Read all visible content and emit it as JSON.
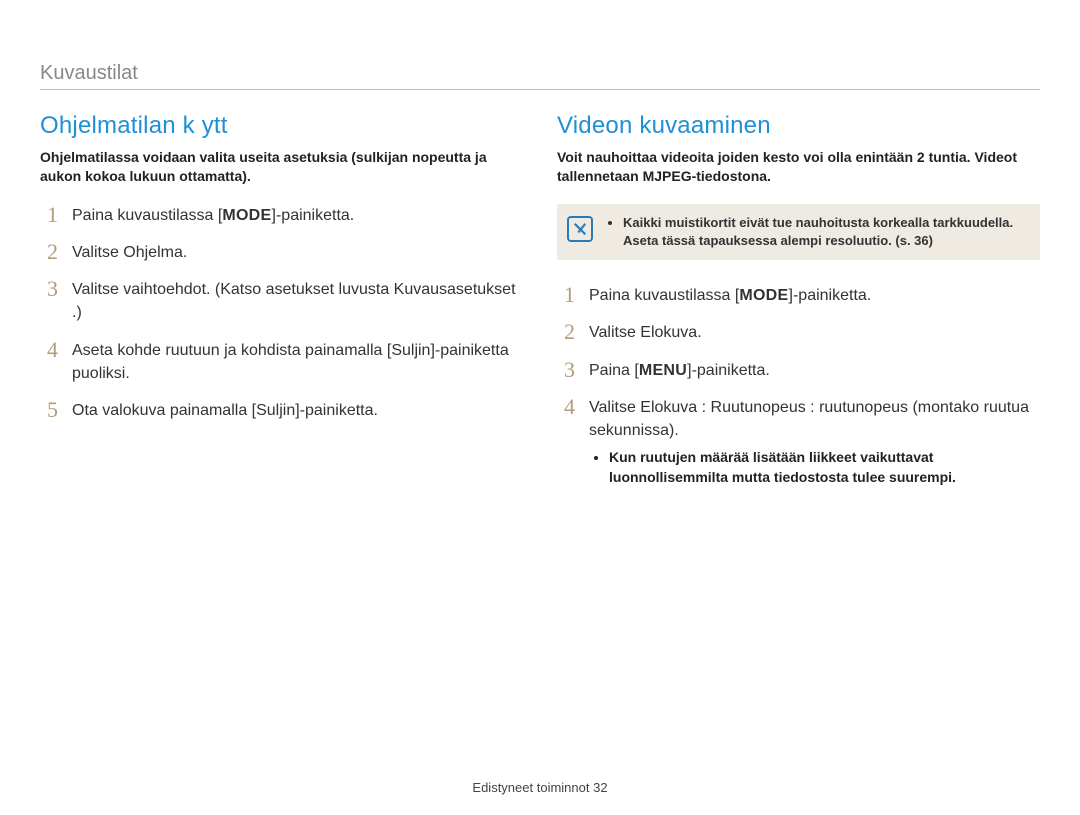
{
  "topic": "Kuvaustilat",
  "left": {
    "title": "Ohjelmatilan k ytt",
    "intro": "Ohjelmatilassa voidaan valita useita asetuksia (sulkijan nopeutta ja aukon kokoa lukuun ottamatta).",
    "steps": {
      "s1a": "Paina kuvaustilassa [",
      "s1key": "MODE",
      "s1b": "]-painiketta.",
      "s2": "Valitse Ohjelma.",
      "s3": "Valitse vaihtoehdot. (Katso asetukset luvusta Kuvausasetukset .)",
      "s4": "Aseta kohde ruutuun ja kohdista painamalla [Suljin]-painiketta puoliksi.",
      "s5": "Ota valokuva painamalla [Suljin]-painiketta."
    }
  },
  "right": {
    "title": "Videon kuvaaminen",
    "intro": "Voit nauhoittaa videoita joiden kesto voi olla enintään 2 tuntia. Videot tallennetaan MJPEG-tiedostona.",
    "note": "Kaikki muistikortit eivät tue nauhoitusta korkealla tarkkuudella. Aseta tässä tapauksessa alempi resoluutio. (s. 36)",
    "steps": {
      "s1a": "Paina kuvaustilassa [",
      "s1key": "MODE",
      "s1b": "]-painiketta.",
      "s2": "Valitse Elokuva.",
      "s3a": "Paina [",
      "s3key": "MENU",
      "s3b": "]-painiketta.",
      "s4": "Valitse Elokuva  :  Ruutunopeus  :  ruutunopeus (montako ruutua sekunnissa).",
      "s4_bullet": "Kun ruutujen määrää lisätään liikkeet vaikuttavat luonnollisemmilta mutta tiedostosta tulee suurempi."
    }
  },
  "footer_label": "Edistyneet toiminnot",
  "footer_page": "32"
}
